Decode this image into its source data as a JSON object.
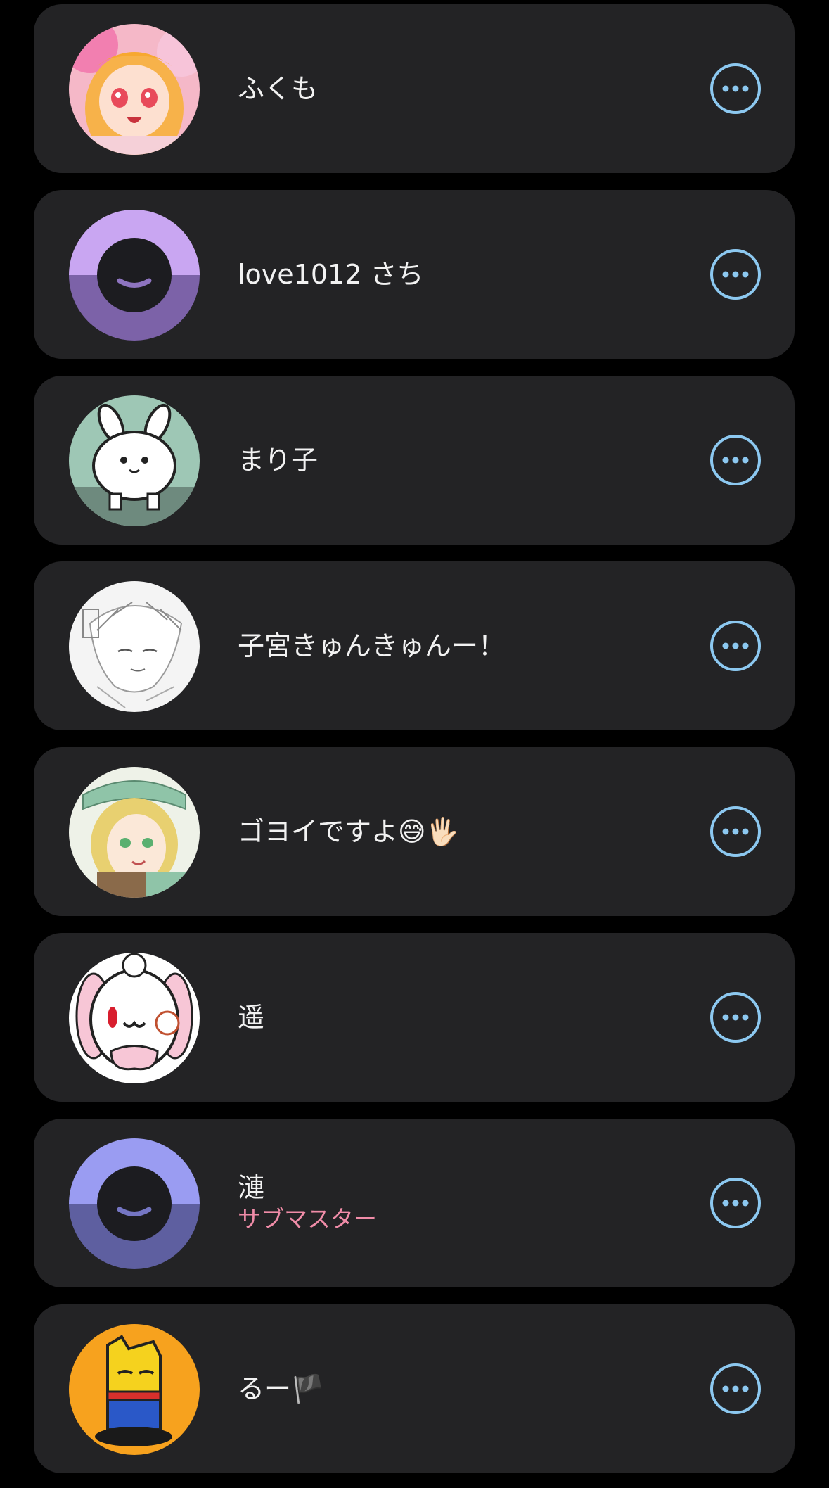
{
  "theme": {
    "background": "#000000",
    "card_background": "#232325",
    "accent": "#8cc8f0",
    "role_color": "#f08ca8"
  },
  "members": [
    {
      "name": "ふくも",
      "avatar": "anime-girl-avatar",
      "more_icon": "more-icon"
    },
    {
      "name": "love1012 さち",
      "avatar": "default-avatar-lavender",
      "more_icon": "more-icon"
    },
    {
      "name": "まり子",
      "avatar": "bunny-character-avatar",
      "more_icon": "more-icon"
    },
    {
      "name": "子宮きゅんきゅんー！",
      "avatar": "sketch-character-avatar",
      "more_icon": "more-icon"
    },
    {
      "name": "ゴヨイですよ😅🖐🏻",
      "avatar": "anime-boy-avatar",
      "more_icon": "more-icon"
    },
    {
      "name": "遥",
      "avatar": "white-bunny-avatar",
      "more_icon": "more-icon"
    },
    {
      "name": "漣",
      "role": "サブマスター",
      "avatar": "default-avatar-blue",
      "more_icon": "more-icon"
    },
    {
      "name": "るー🏴",
      "avatar": "yellow-character-avatar",
      "more_icon": "more-icon"
    }
  ]
}
